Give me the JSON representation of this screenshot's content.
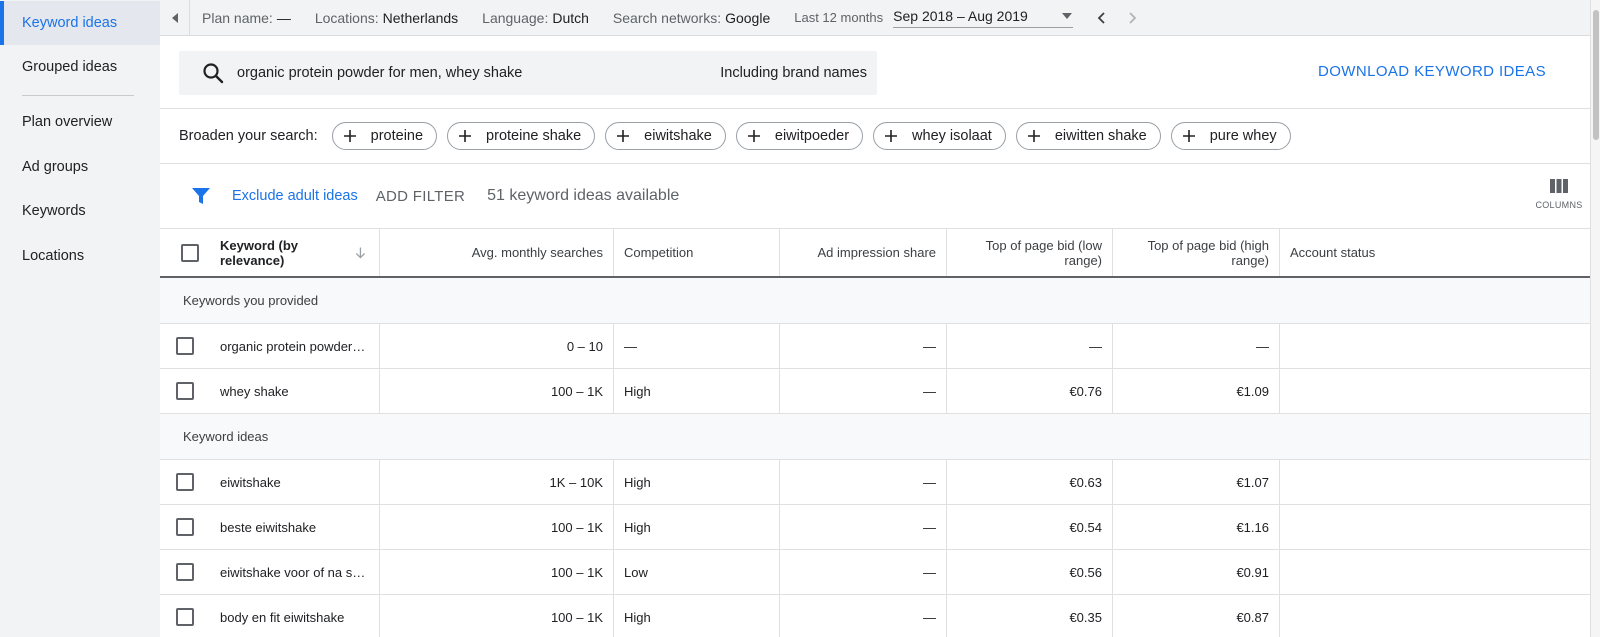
{
  "sidebar": {
    "items": [
      {
        "label": "Keyword ideas",
        "active": true
      },
      {
        "label": "Grouped ideas"
      },
      {
        "label": "Plan overview"
      },
      {
        "label": "Ad groups"
      },
      {
        "label": "Keywords"
      },
      {
        "label": "Locations"
      }
    ]
  },
  "topbar": {
    "plan_label": "Plan name:",
    "plan_value": "—",
    "locations_label": "Locations:",
    "locations_value": "Netherlands",
    "language_label": "Language:",
    "language_value": "Dutch",
    "networks_label": "Search networks:",
    "networks_value": "Google",
    "daterange_label": "Last 12 months",
    "daterange_value": "Sep 2018 – Aug 2019"
  },
  "search": {
    "query": "organic protein powder for men, whey shake",
    "brand_option": "Including brand names",
    "download_label": "DOWNLOAD KEYWORD IDEAS"
  },
  "broaden": {
    "label": "Broaden your search:",
    "chips": [
      "proteine",
      "proteine shake",
      "eiwitshake",
      "eiwitpoeder",
      "whey isolaat",
      "eiwitten shake",
      "pure whey"
    ]
  },
  "filters": {
    "exclude_label": "Exclude adult ideas",
    "add_filter_label": "ADD FILTER",
    "count_text": "51 keyword ideas available",
    "columns_label": "COLUMNS"
  },
  "table": {
    "headers": {
      "keyword": "Keyword (by relevance)",
      "avg": "Avg. monthly searches",
      "competition": "Competition",
      "ad_share": "Ad impression share",
      "bid_low": "Top of page bid (low range)",
      "bid_high": "Top of page bid (high range)",
      "account": "Account status"
    },
    "groups": [
      {
        "title": "Keywords you provided",
        "rows": [
          {
            "keyword": "organic protein powder…",
            "avg": "0 – 10",
            "competition": "—",
            "ad_share": "—",
            "bid_low": "—",
            "bid_high": "—"
          },
          {
            "keyword": "whey shake",
            "avg": "100 – 1K",
            "competition": "High",
            "ad_share": "—",
            "bid_low": "€0.76",
            "bid_high": "€1.09"
          }
        ]
      },
      {
        "title": "Keyword ideas",
        "rows": [
          {
            "keyword": "eiwitshake",
            "avg": "1K – 10K",
            "competition": "High",
            "ad_share": "—",
            "bid_low": "€0.63",
            "bid_high": "€1.07"
          },
          {
            "keyword": "beste eiwitshake",
            "avg": "100 – 1K",
            "competition": "High",
            "ad_share": "—",
            "bid_low": "€0.54",
            "bid_high": "€1.16"
          },
          {
            "keyword": "eiwitshake voor of na s…",
            "avg": "100 – 1K",
            "competition": "Low",
            "ad_share": "—",
            "bid_low": "€0.56",
            "bid_high": "€0.91"
          },
          {
            "keyword": "body en fit eiwitshake",
            "avg": "100 – 1K",
            "competition": "High",
            "ad_share": "—",
            "bid_low": "€0.35",
            "bid_high": "€0.87"
          }
        ]
      }
    ]
  },
  "colors": {
    "accent": "#1a73e8",
    "sidebar_bg": "#f1f3f4"
  }
}
